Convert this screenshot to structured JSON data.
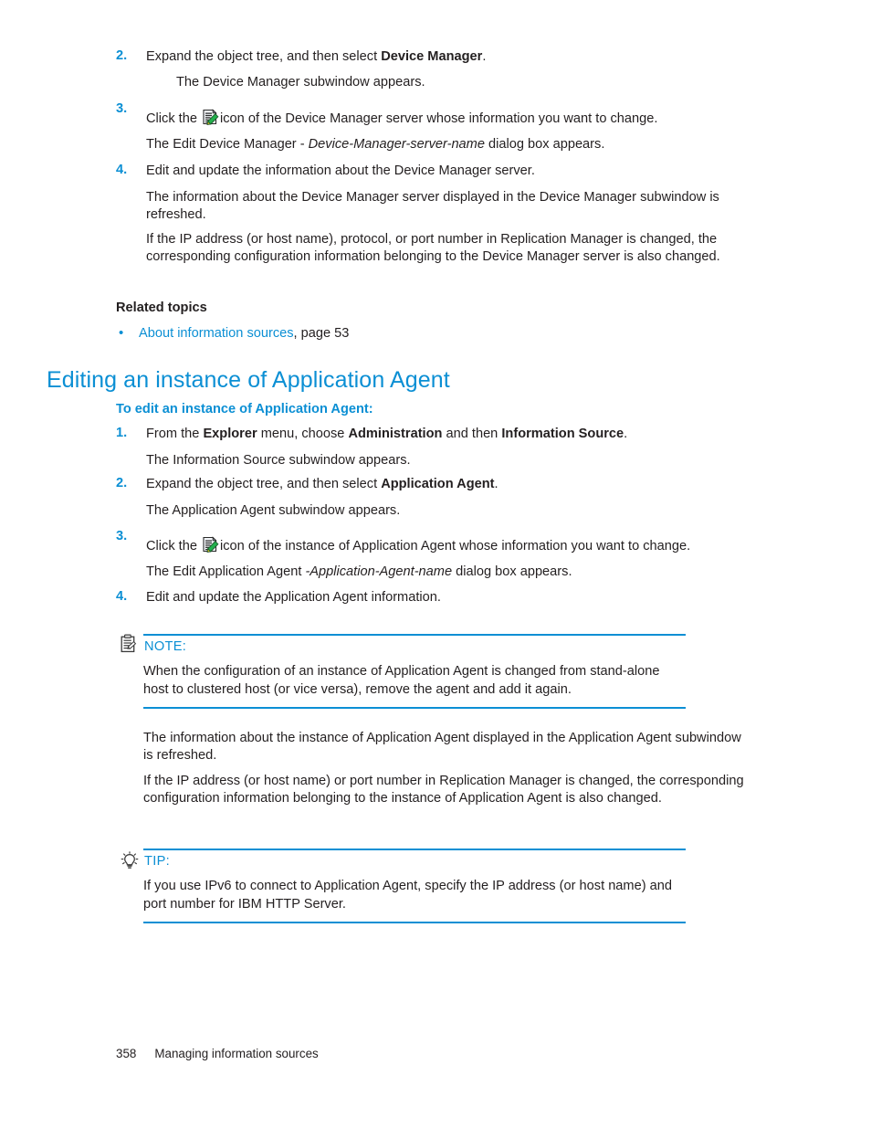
{
  "document": {
    "footer": {
      "page_number": "358",
      "chapter": "Managing information sources"
    },
    "colors": {
      "accent_blue": "#0b8fd4",
      "body_black": "#231f20"
    }
  },
  "top_section": {
    "steps": [
      {
        "number": "2.",
        "text_parts": [
          {
            "text": "Expand the object tree, and then select ",
            "style": "normal"
          },
          {
            "text": "Device Manager",
            "style": "bold"
          },
          {
            "text": ".",
            "style": "normal"
          }
        ],
        "plain": "Expand the object tree, and then select Device Manager.",
        "result": "The Device Manager subwindow appears."
      },
      {
        "number": "3.",
        "prefix": "Click the ",
        "icon": "edit-document-icon",
        "suffix": "icon of the Device Manager server whose information you want to change.",
        "result_prefix": "The Edit Device Manager - ",
        "result_italic": "Device-Manager-server-name",
        "result_suffix": " dialog box appears."
      },
      {
        "number": "4.",
        "plain": "Edit and update the information about the Device Manager server.",
        "para1": "The information about the Device Manager server displayed in the Device Manager subwindow is refreshed.",
        "para2": "If the IP address (or host name), protocol, or port number in Replication Manager is changed, the corresponding configuration information belonging to the Device Manager server is also changed."
      }
    ],
    "related_topics": {
      "heading": "Related topics",
      "items": [
        {
          "link_text": "About information sources",
          "tail": ", page 53"
        }
      ]
    }
  },
  "main_section": {
    "heading": "Editing an instance of Application Agent",
    "subheading": "To edit an instance of Application Agent:",
    "steps": [
      {
        "number": "1.",
        "parts": [
          {
            "text": "From the ",
            "style": "normal"
          },
          {
            "text": "Explorer",
            "style": "bold"
          },
          {
            "text": " menu, choose ",
            "style": "normal"
          },
          {
            "text": "Administration",
            "style": "bold"
          },
          {
            "text": " and then ",
            "style": "normal"
          },
          {
            "text": "Information Source",
            "style": "bold"
          },
          {
            "text": ".",
            "style": "normal"
          }
        ],
        "result": "The Information Source subwindow appears."
      },
      {
        "number": "2.",
        "parts": [
          {
            "text": "Expand the object tree, and then select ",
            "style": "normal"
          },
          {
            "text": "Application Agent",
            "style": "bold"
          },
          {
            "text": ".",
            "style": "normal"
          }
        ],
        "result": "The Application Agent subwindow appears."
      },
      {
        "number": "3.",
        "prefix": "Click the ",
        "icon": "edit-document-icon",
        "suffix": "icon of the instance of Application Agent whose information you want to change.",
        "result_prefix": "The Edit Application Agent ",
        "result_italic": "-Application-Agent-name",
        "result_suffix": " dialog box appears."
      },
      {
        "number": "4.",
        "plain": "Edit and update the Application Agent information."
      }
    ],
    "note": {
      "icon": "note-clipboard-icon",
      "label": "NOTE:",
      "text": "When the configuration of an instance of Application Agent is changed from stand-alone host to clustered host (or vice versa), remove the agent and add it again."
    },
    "after_note": {
      "para1": "The information about the instance of Application Agent displayed in the Application Agent subwindow is refreshed.",
      "para2": "If the IP address (or host name) or port number in Replication Manager is changed, the corresponding configuration information belonging to the instance of Application Agent is also changed."
    },
    "tip": {
      "icon": "lightbulb-icon",
      "label": "TIP:",
      "text": "If you use IPv6 to connect to Application Agent, specify the IP address (or host name) and port number for IBM HTTP Server."
    }
  }
}
